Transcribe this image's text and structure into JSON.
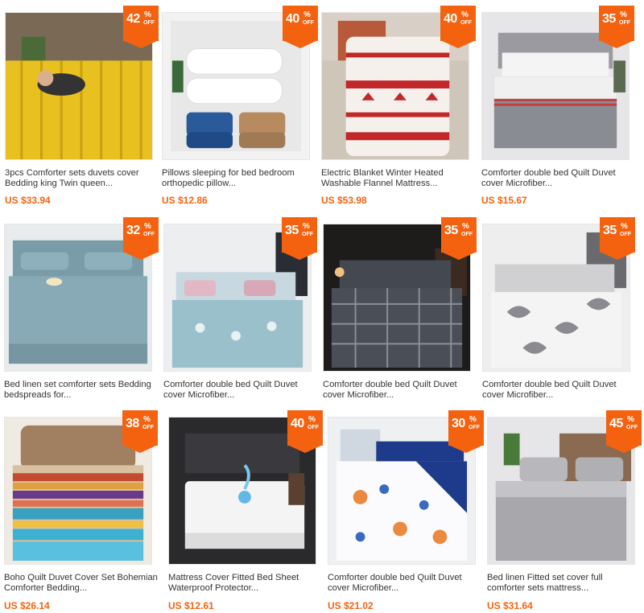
{
  "products": [
    {
      "line1": "3pcs Comforter sets duvets cover",
      "line2": "Bedding king Twin queen...",
      "price": "US $33.94",
      "discount": "42"
    },
    {
      "line1": "Pillows sleeping for bed bedroom",
      "line2": "orthopedic pillow...",
      "price": "US $12.86",
      "discount": "40"
    },
    {
      "line1": "Electric Blanket Winter Heated",
      "line2": "Washable Flannel Mattress...",
      "price": "US $53.98",
      "discount": "40"
    },
    {
      "line1": "Comforter double bed Quilt Duvet",
      "line2": "cover Microfiber...",
      "price": "US $15.67",
      "discount": "35"
    },
    {
      "line1": "Bed linen set comforter sets Bedding",
      "line2": "bedspreads for...",
      "price": "",
      "discount": "32"
    },
    {
      "line1": "Comforter double bed Quilt Duvet",
      "line2": "cover Microfiber...",
      "price": "",
      "discount": "35"
    },
    {
      "line1": "Comforter double bed Quilt Duvet",
      "line2": "cover Microfiber...",
      "price": "",
      "discount": "35"
    },
    {
      "line1": "Comforter double bed Quilt Duvet",
      "line2": "cover Microfiber...",
      "price": "",
      "discount": "35"
    },
    {
      "line1": "Boho Quilt Duvet Cover Set Bohemian",
      "line2": "Comforter Bedding...",
      "price": "US $26.14",
      "discount": "38"
    },
    {
      "line1": "Mattress Cover Fitted Bed Sheet",
      "line2": "Waterproof Protector...",
      "price": "US $12.61",
      "discount": "40"
    },
    {
      "line1": "Comforter double bed Quilt Duvet",
      "line2": "cover Microfiber...",
      "price": "US $21.02",
      "discount": "30"
    },
    {
      "line1": "Bed linen Fitted set cover full",
      "line2": "comforter sets mattress...",
      "price": "US $31.64",
      "discount": "45"
    }
  ],
  "badge": {
    "pct": "%",
    "off": "OFF"
  },
  "colors": {
    "accent": "#f5620f",
    "price": "#f5620f",
    "border": "#e6e6e6"
  }
}
